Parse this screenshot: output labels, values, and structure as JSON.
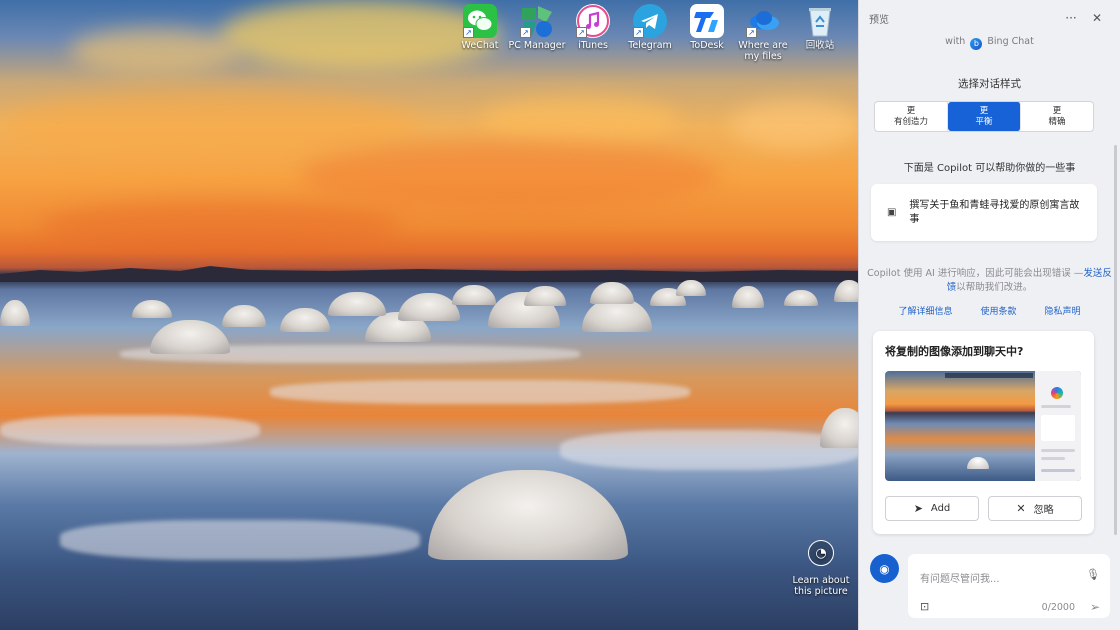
{
  "desktop": {
    "icons": [
      {
        "label": "WeChat",
        "icon": "wechat-icon",
        "color": "#2bc145"
      },
      {
        "label": "PC Manager",
        "icon": "pc-manager-icon",
        "color": "#3aa85a"
      },
      {
        "label": "iTunes",
        "icon": "itunes-icon",
        "color": "#e94b8f"
      },
      {
        "label": "Telegram",
        "icon": "telegram-icon",
        "color": "#2aa3df"
      },
      {
        "label": "ToDesk",
        "icon": "todesk-icon",
        "color": "#1a6ff0"
      },
      {
        "label": "Where are my files",
        "icon": "onedrive-icon",
        "color": "#1e7be6"
      },
      {
        "label": "回收站",
        "icon": "recycle-bin-icon",
        "color": "#cfe3ef"
      }
    ],
    "learn_about": "Learn about this picture"
  },
  "copilot": {
    "title": "预览",
    "with_label": "with",
    "bing_chat": "Bing Chat",
    "style_label": "选择对话样式",
    "styles": [
      {
        "top": "更",
        "bottom": "有创造力"
      },
      {
        "top": "更",
        "bottom": "平衡"
      },
      {
        "top": "更",
        "bottom": "精确"
      }
    ],
    "help_title": "下面是 Copilot 可以帮助你做的一些事",
    "suggestion": "撰写关于鱼和青蛙寻找爱的原创寓言故事",
    "disclaimer_1": "Copilot 使用 AI 进行响应，因此可能会出现错误 —",
    "disclaimer_link": "发送反馈",
    "disclaimer_2": "以帮助我们改进。",
    "links": [
      "了解详细信息",
      "使用条款",
      "隐私声明"
    ],
    "card": {
      "title": "将复制的图像添加到聊天中?",
      "add": "Add",
      "ignore": "忽略"
    },
    "input": {
      "placeholder": "有问题尽管问我...",
      "counter": "0/2000"
    },
    "accent": "#1762d6"
  }
}
